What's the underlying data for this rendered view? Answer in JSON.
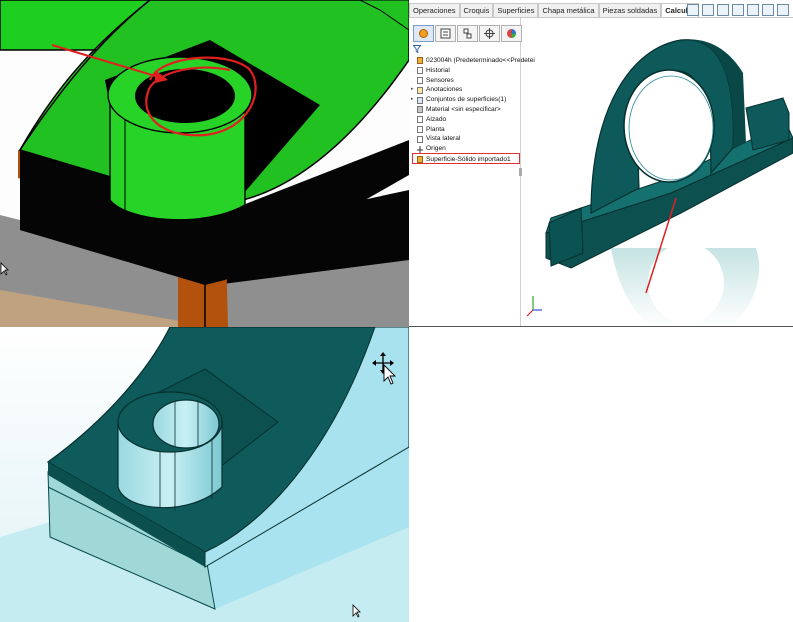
{
  "command_manager": {
    "tabs": [
      "Operaciones",
      "Croquis",
      "Superficies",
      "Chapa metálica",
      "Piezas soldadas",
      "Calcular"
    ],
    "active_tab": "Calcular"
  },
  "feature_tree": {
    "items": [
      {
        "label": "023004h  (Predeterminado<<Predetei",
        "icon": "part-icon"
      },
      {
        "label": "Historial",
        "icon": "history-icon"
      },
      {
        "label": "Sensores",
        "icon": "sensor-icon"
      },
      {
        "label": "Anotaciones",
        "icon": "annotation-icon"
      },
      {
        "label": "Conjuntos de superficies(1)",
        "icon": "surface-body-folder-icon"
      },
      {
        "label": "Material <sin especificar>",
        "icon": "material-icon"
      },
      {
        "label": "Alzado",
        "icon": "plane-icon"
      },
      {
        "label": "Planta",
        "icon": "plane-icon"
      },
      {
        "label": "Vista lateral",
        "icon": "plane-icon"
      },
      {
        "label": "Origen",
        "icon": "origin-icon"
      },
      {
        "label": "Superficie-Sólido importado1",
        "icon": "imported-surface-icon",
        "highlighted": true
      }
    ]
  },
  "colors": {
    "teal_model": "#0e5a5a",
    "green_model": "#22c122",
    "callout_red": "#e02020"
  }
}
